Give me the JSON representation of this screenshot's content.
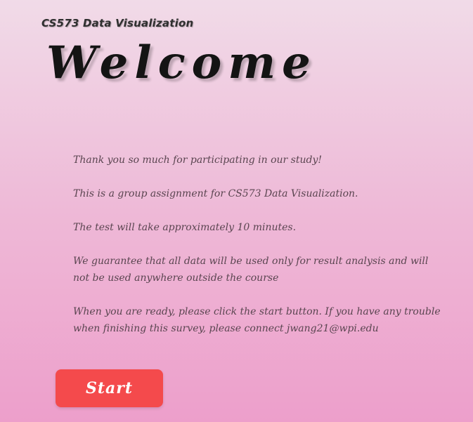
{
  "header": {
    "app_title": "CS573 Data Visualization"
  },
  "hero": {
    "welcome": "Welcome"
  },
  "message": {
    "paragraphs": [
      "Thank you so much for participating in our study!",
      "This is a group assignment for CS573 Data Visualization.",
      "The test will take approximately 10 minutes.",
      "We guarantee that all data will be used only for result analysis and will not be used anywhere outside the course",
      "When you are ready, please click the start button. If you have any trouble when finishing this survey, please connect jwang21@wpi.edu"
    ]
  },
  "actions": {
    "start_label": "Start"
  },
  "colors": {
    "button_bg": "#f44a4c",
    "text": "#5a4550",
    "background_top": "#f1dbe8",
    "background_bottom": "#ed9fcb"
  }
}
